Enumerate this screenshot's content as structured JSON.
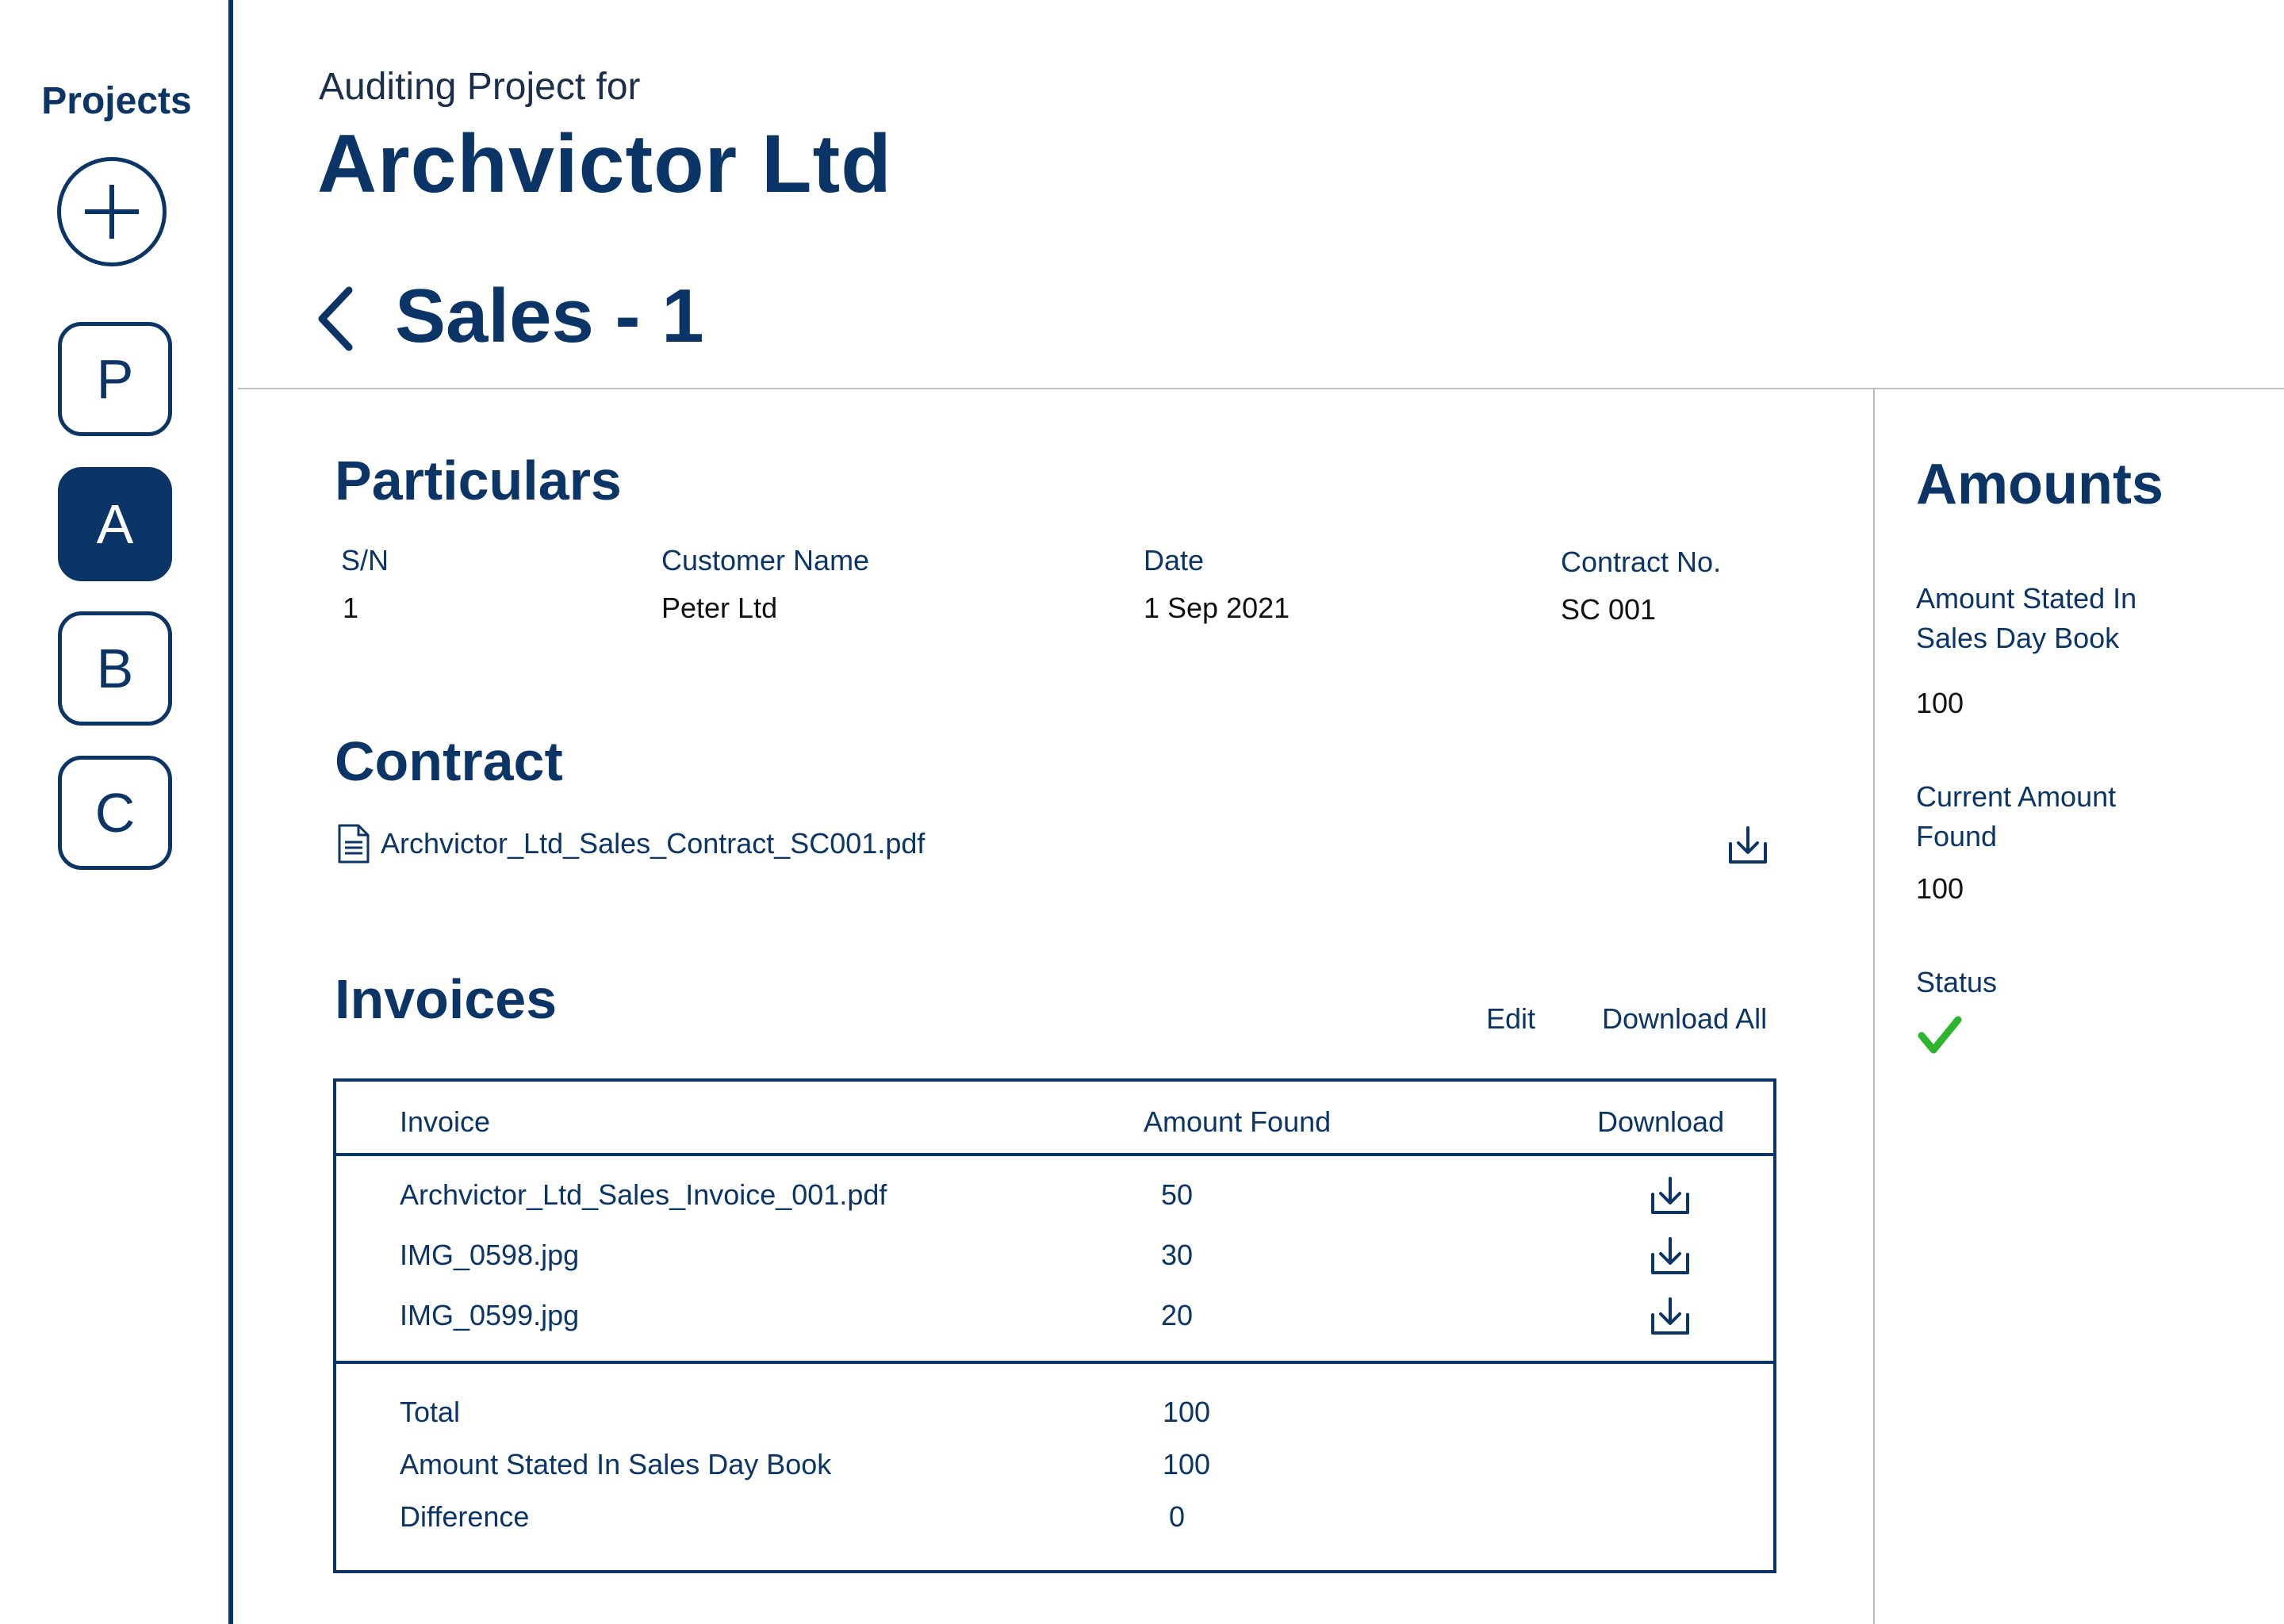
{
  "sidebar": {
    "title": "Projects",
    "projects": [
      {
        "label": "P"
      },
      {
        "label": "A"
      },
      {
        "label": "B"
      },
      {
        "label": "C"
      }
    ]
  },
  "header": {
    "subtitle": "Auditing Project for",
    "title": "Archvictor Ltd",
    "page_title": "Sales - 1"
  },
  "particulars": {
    "heading": "Particulars",
    "fields": [
      {
        "label": "S/N",
        "value": "1"
      },
      {
        "label": "Customer Name",
        "value": "Peter Ltd"
      },
      {
        "label": "Date",
        "value": "1 Sep 2021"
      },
      {
        "label": "Contract No.",
        "value": "SC 001"
      }
    ]
  },
  "contract": {
    "heading": "Contract",
    "file_name": "Archvictor_Ltd_Sales_Contract_SC001.pdf"
  },
  "invoices": {
    "heading": "Invoices",
    "edit_label": "Edit",
    "download_all_label": "Download All",
    "columns": [
      "Invoice",
      "Amount Found",
      "Download"
    ],
    "rows": [
      {
        "file": "Archvictor_Ltd_Sales_Invoice_001.pdf",
        "amount": "50"
      },
      {
        "file": "IMG_0598.jpg",
        "amount": "30"
      },
      {
        "file": "IMG_0599.jpg",
        "amount": "20"
      }
    ],
    "summary": [
      {
        "label": "Total",
        "value": "100"
      },
      {
        "label": "Amount Stated In Sales Day Book",
        "value": "100"
      },
      {
        "label": "Difference",
        "value": "0"
      }
    ]
  },
  "amounts": {
    "heading": "Amounts",
    "stated_label": "Amount Stated In Sales Day Book",
    "stated_value": "100",
    "current_label": "Current Amount Found",
    "current_value": "100",
    "status_label": "Status",
    "status_icon": "check-icon",
    "status_color": "#2db52d"
  },
  "colors": {
    "primary": "#0b3567",
    "divider": "#bdbdbd",
    "success": "#2db52d"
  }
}
